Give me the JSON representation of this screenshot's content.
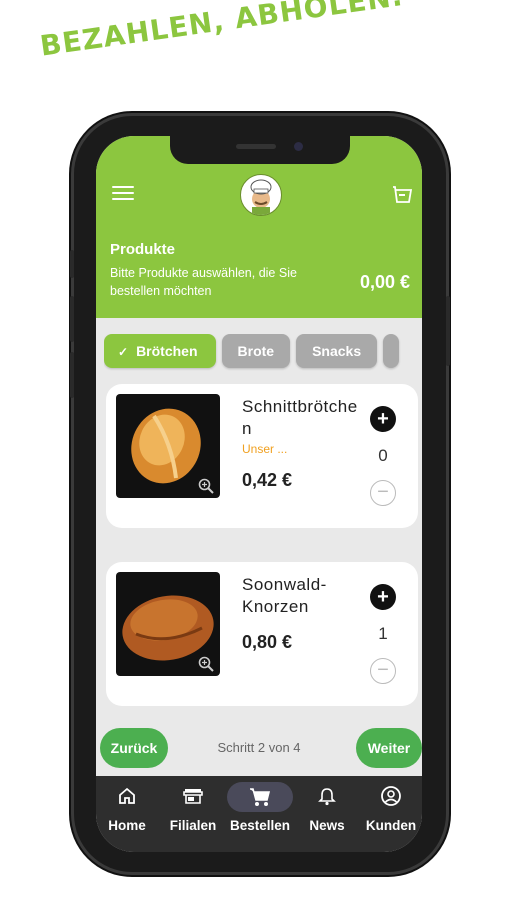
{
  "headline": "BEZAHLEN, ABHOLEN.",
  "header": {
    "title": "Produkte",
    "subtitle": "Bitte Produkte auswählen, die Sie bestellen möchten",
    "total": "0,00 €"
  },
  "categories": [
    {
      "label": "Brötchen",
      "active": true
    },
    {
      "label": "Brote",
      "active": false
    },
    {
      "label": "Snacks",
      "active": false
    }
  ],
  "products": [
    {
      "name": "Schnittbrötchen",
      "description": "Unser ...",
      "price": "0,42 €",
      "quantity": "0"
    },
    {
      "name": "Soonwald-Knorzen",
      "description": "",
      "price": "0,80 €",
      "quantity": "1"
    }
  ],
  "footer": {
    "back_label": "Zurück",
    "step_text": "Schritt 2 von 4",
    "next_label": "Weiter"
  },
  "nav": [
    {
      "label": "Home",
      "icon": "home-icon"
    },
    {
      "label": "Filialen",
      "icon": "store-icon"
    },
    {
      "label": "Bestellen",
      "icon": "cart-icon",
      "active": true
    },
    {
      "label": "News",
      "icon": "bell-icon"
    },
    {
      "label": "Kunden",
      "icon": "account-icon"
    }
  ],
  "colors": {
    "brand": "#8cc63f",
    "button": "#4caf50",
    "accent": "#f0a020",
    "nav_bg": "#2e2e2e"
  }
}
